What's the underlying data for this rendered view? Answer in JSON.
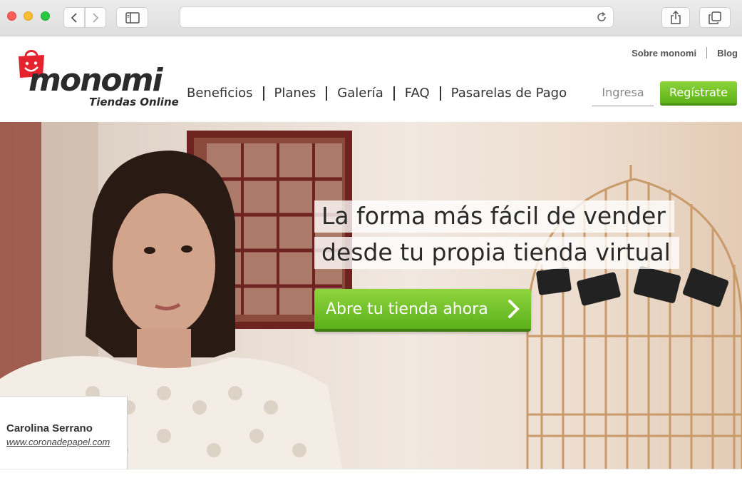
{
  "browser": {
    "url": "",
    "icons": {
      "back": "chevron-left-icon",
      "forward": "chevron-right-icon",
      "sidebar": "sidebar-icon",
      "reload": "reload-icon",
      "share": "share-icon",
      "tabs": "tabs-icon"
    }
  },
  "site": {
    "logo": {
      "name": "monomi",
      "tagline": "Tiendas Online"
    },
    "top_links": [
      "Sobre monomi",
      "Blog"
    ],
    "nav": [
      "Beneficios",
      "Planes",
      "Galería",
      "FAQ",
      "Pasarelas de Pago"
    ],
    "login_label": "Ingresa",
    "register_label": "Regístrate"
  },
  "hero": {
    "headline_line1": "La forma más fácil de vender",
    "headline_line2": "desde tu propia tienda virtual",
    "cta_label": "Abre tu tienda ahora",
    "credit_name": "Carolina Serrano",
    "credit_url": "www.coronadepapel.com"
  },
  "colors": {
    "brand_green": "#6cc02a",
    "logo_red": "#e5232f",
    "text_dark": "#333333"
  }
}
